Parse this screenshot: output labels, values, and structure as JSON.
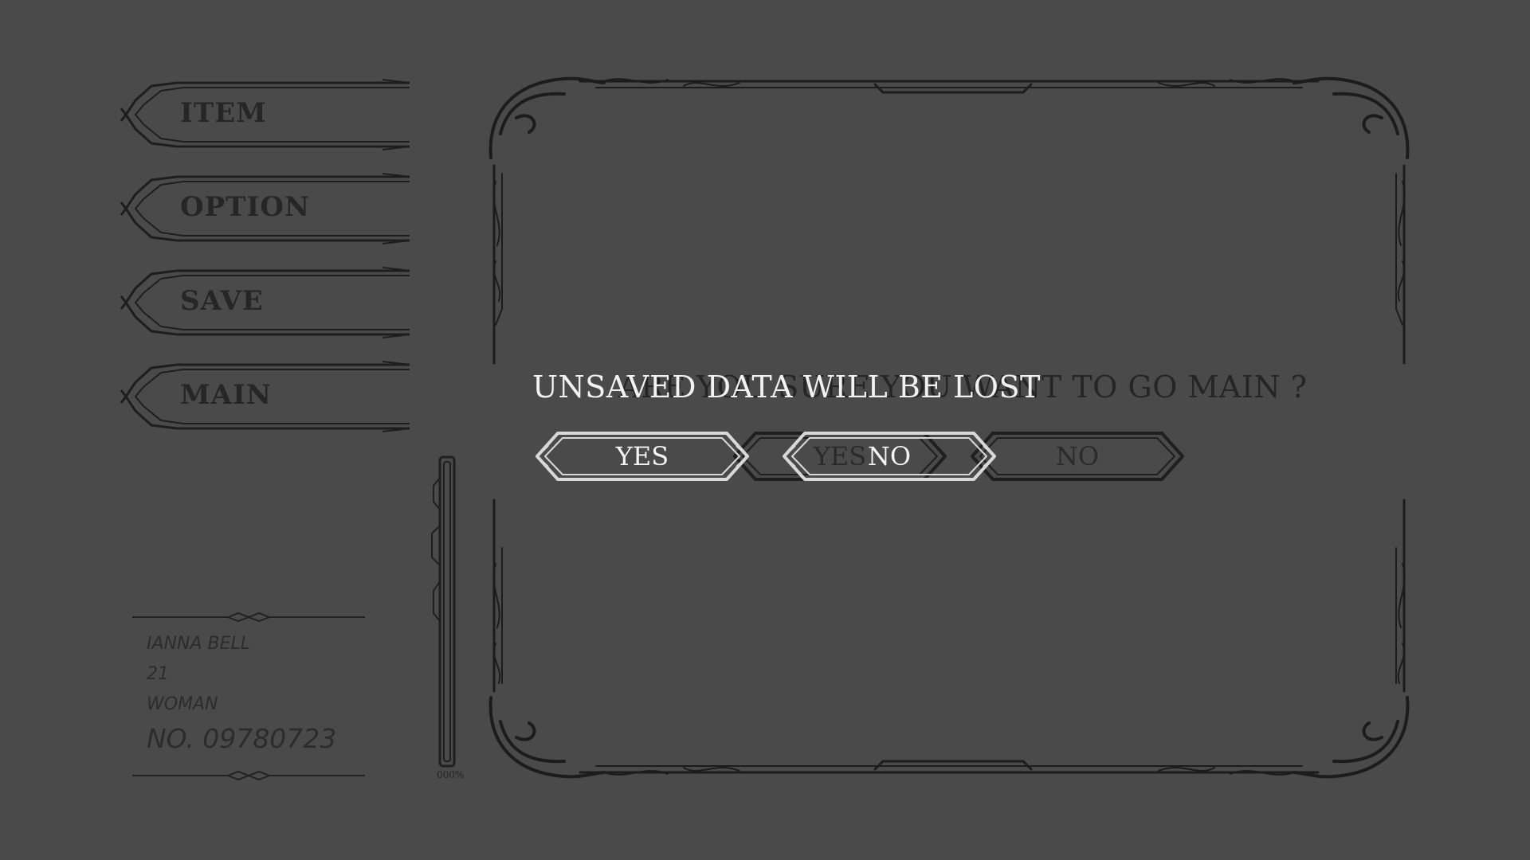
{
  "menu": {
    "items": [
      {
        "label": "ITEM"
      },
      {
        "label": "OPTION"
      },
      {
        "label": "SAVE"
      },
      {
        "label": "MAIN"
      }
    ]
  },
  "character": {
    "name": "IANNA BELL",
    "age": "21",
    "gender": "WOMAN",
    "number": "NO. 09780723"
  },
  "gauge": {
    "label": "000%",
    "level": 0
  },
  "dialog": {
    "question": "ARE YOU SURE YOU WANT TO GO MAIN ?",
    "warning": "UNSAVED DATA WILL BE LOST",
    "buttons": {
      "back_yes": "YES",
      "back_no": "NO",
      "front_yes": "YES",
      "front_no": "NO"
    }
  },
  "colors": {
    "background": "#4a4a4a",
    "frame": "#1f1f1f",
    "highlight": "#d8d8d8"
  }
}
